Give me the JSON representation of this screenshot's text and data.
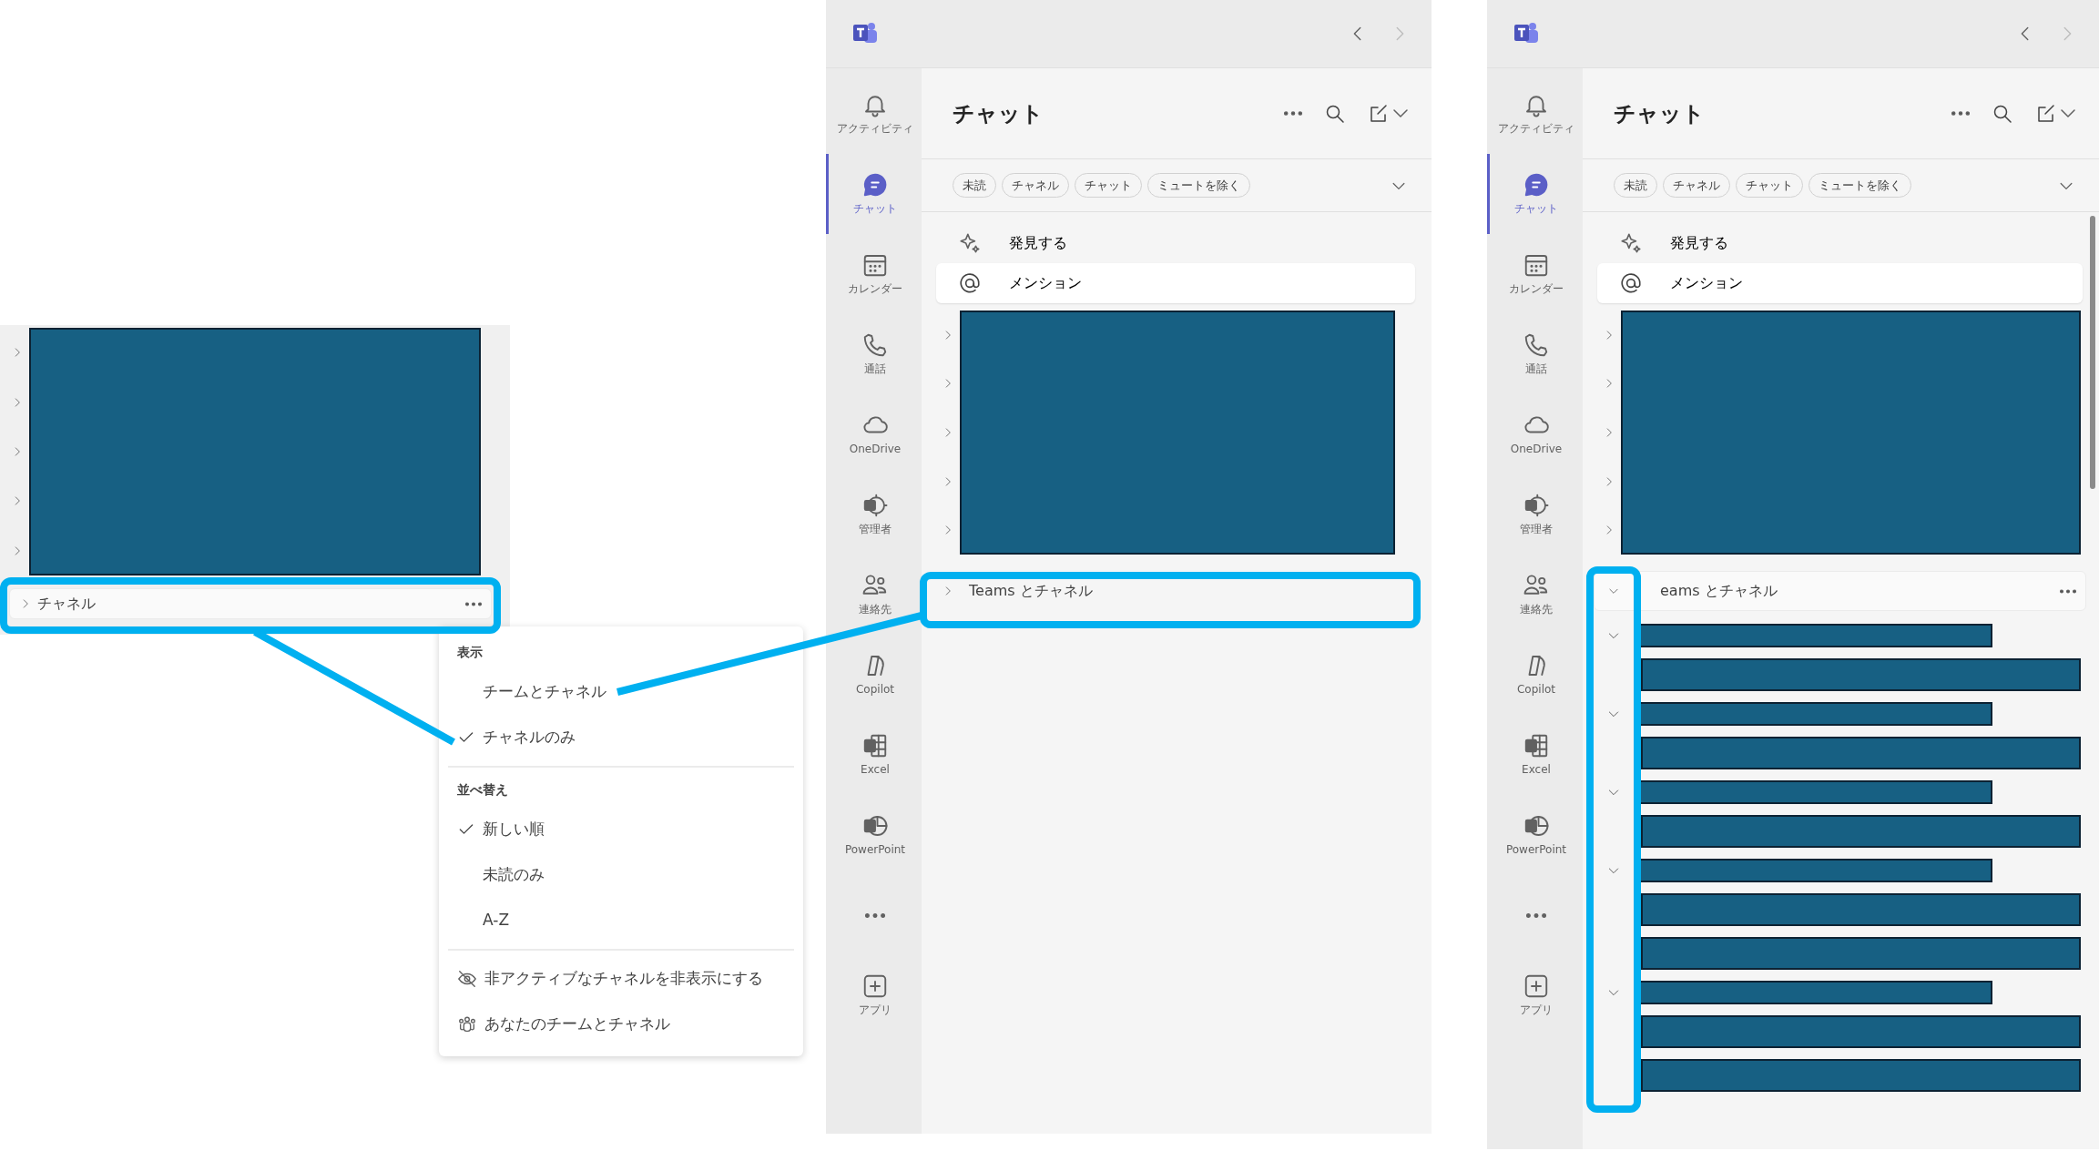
{
  "left_crop": {
    "rows": [
      {
        "expanded": false
      },
      {
        "expanded": false
      },
      {
        "expanded": false
      },
      {
        "expanded": false
      },
      {
        "expanded": false
      }
    ],
    "section": {
      "label": "チャネル",
      "expanded": false,
      "focused": true
    },
    "menu": {
      "groups": [
        {
          "heading": "表示",
          "items": [
            {
              "label": "チームとチャネル",
              "checked": false
            },
            {
              "label": "チャネルのみ",
              "checked": true
            }
          ]
        },
        {
          "heading": "並べ替え",
          "items": [
            {
              "label": "新しい順",
              "checked": true
            },
            {
              "label": "未読のみ",
              "checked": false
            },
            {
              "label": "A-Z",
              "checked": false
            }
          ]
        }
      ],
      "actions": [
        "非アクティブなチャネルを非表示にする",
        "あなたのチームとチャネル"
      ]
    }
  },
  "windows": [
    {
      "rail": [
        {
          "kind": "app",
          "label": "アクティビティ",
          "selected": false
        },
        {
          "kind": "app",
          "label": "チャット",
          "selected": true
        },
        {
          "kind": "app",
          "label": "カレンダー",
          "selected": false
        },
        {
          "kind": "app",
          "label": "通話",
          "selected": false
        },
        {
          "kind": "app",
          "label": "OneDrive",
          "selected": false
        },
        {
          "kind": "app",
          "label": "管理者",
          "selected": false
        },
        {
          "kind": "app",
          "label": "連絡先",
          "selected": false
        },
        {
          "kind": "app",
          "label": "Copilot",
          "selected": false
        },
        {
          "kind": "app",
          "label": "Excel",
          "selected": false
        },
        {
          "kind": "app",
          "label": "PowerPoint",
          "selected": false
        },
        {
          "kind": "more",
          "selected": false
        },
        {
          "kind": "app",
          "label": "アプリ",
          "selected": false
        }
      ],
      "title": "チャット",
      "filters": [
        {
          "label": "未読",
          "selected": false
        },
        {
          "label": "チャネル",
          "selected": false
        },
        {
          "label": "チャット",
          "selected": false
        },
        {
          "label": "ミュートを除く",
          "selected": false
        }
      ],
      "quick_links": [
        {
          "label": "発見する",
          "selected": false
        },
        {
          "label": "メンション",
          "selected": true
        }
      ],
      "rows": [
        {
          "expanded": false
        },
        {
          "expanded": false
        },
        {
          "expanded": false
        },
        {
          "expanded": false
        },
        {
          "expanded": false
        }
      ],
      "section": {
        "label": "Teams とチャネル",
        "expanded": false,
        "focused": false
      }
    },
    {
      "rail": [
        {
          "kind": "app",
          "label": "アクティビティ",
          "selected": false
        },
        {
          "kind": "app",
          "label": "チャット",
          "selected": true
        },
        {
          "kind": "app",
          "label": "カレンダー",
          "selected": false
        },
        {
          "kind": "app",
          "label": "通話",
          "selected": false
        },
        {
          "kind": "app",
          "label": "OneDrive",
          "selected": false
        },
        {
          "kind": "app",
          "label": "管理者",
          "selected": false
        },
        {
          "kind": "app",
          "label": "連絡先",
          "selected": false
        },
        {
          "kind": "app",
          "label": "Copilot",
          "selected": false
        },
        {
          "kind": "app",
          "label": "Excel",
          "selected": false
        },
        {
          "kind": "app",
          "label": "PowerPoint",
          "selected": false
        },
        {
          "kind": "more",
          "selected": false
        },
        {
          "kind": "app",
          "label": "アプリ",
          "selected": false
        }
      ],
      "title": "チャット",
      "filters": [
        {
          "label": "未読",
          "selected": false
        },
        {
          "label": "チャネル",
          "selected": false
        },
        {
          "label": "チャット",
          "selected": false
        },
        {
          "label": "ミュートを除く",
          "selected": false
        }
      ],
      "quick_links": [
        {
          "label": "発見する",
          "selected": false
        },
        {
          "label": "メンション",
          "selected": true
        }
      ],
      "rows": [
        {
          "expanded": false
        },
        {
          "expanded": false
        },
        {
          "expanded": false
        },
        {
          "expanded": false
        },
        {
          "expanded": false
        }
      ],
      "section": {
        "label": "eams とチャネル",
        "expanded": true,
        "focused": true
      },
      "teams": [
        {
          "expanded": true,
          "channels": [
            {
              "redacted": true
            }
          ]
        },
        {
          "expanded": true,
          "channels": [
            {
              "redacted": true
            }
          ]
        },
        {
          "expanded": true,
          "channels": [
            {
              "redacted": true
            }
          ]
        },
        {
          "expanded": true,
          "channels": [
            {
              "redacted": true
            },
            {
              "redacted": true
            }
          ]
        },
        {
          "expanded": true,
          "channels": [
            {
              "redacted": true
            },
            {
              "redacted": true
            }
          ]
        }
      ]
    }
  ]
}
